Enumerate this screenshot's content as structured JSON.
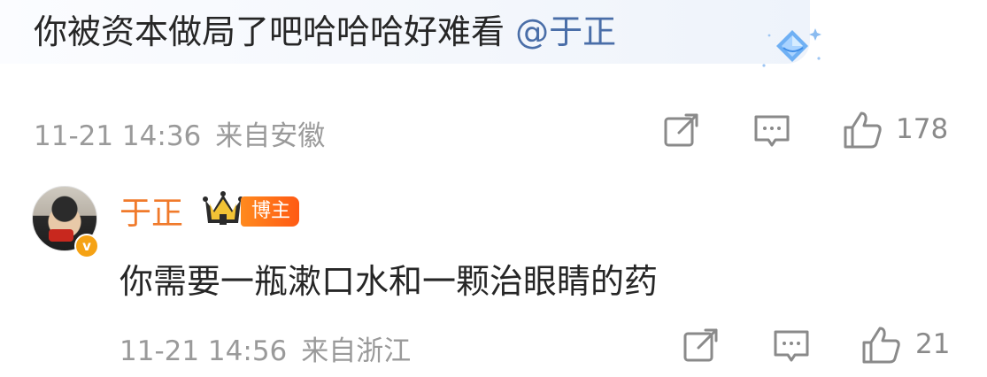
{
  "parent_comment": {
    "text": "你被资本做局了吧哈哈哈好难看 ",
    "mention": "@于正",
    "time": "11-21 14:36",
    "location": "来自安徽",
    "likes": "178",
    "badge_icon": "diamond-gem-icon"
  },
  "reply": {
    "username": "于正",
    "tag": "博主",
    "verified_label": "v",
    "text": "你需要一瓶漱口水和一颗治眼睛的药",
    "time": "11-21 14:56",
    "location": "来自浙江",
    "likes": "21"
  },
  "colors": {
    "username": "#f07a2b",
    "tag_bg": "#ff6a14",
    "mention": "#4a6ea8",
    "meta": "#9a9a9a"
  }
}
